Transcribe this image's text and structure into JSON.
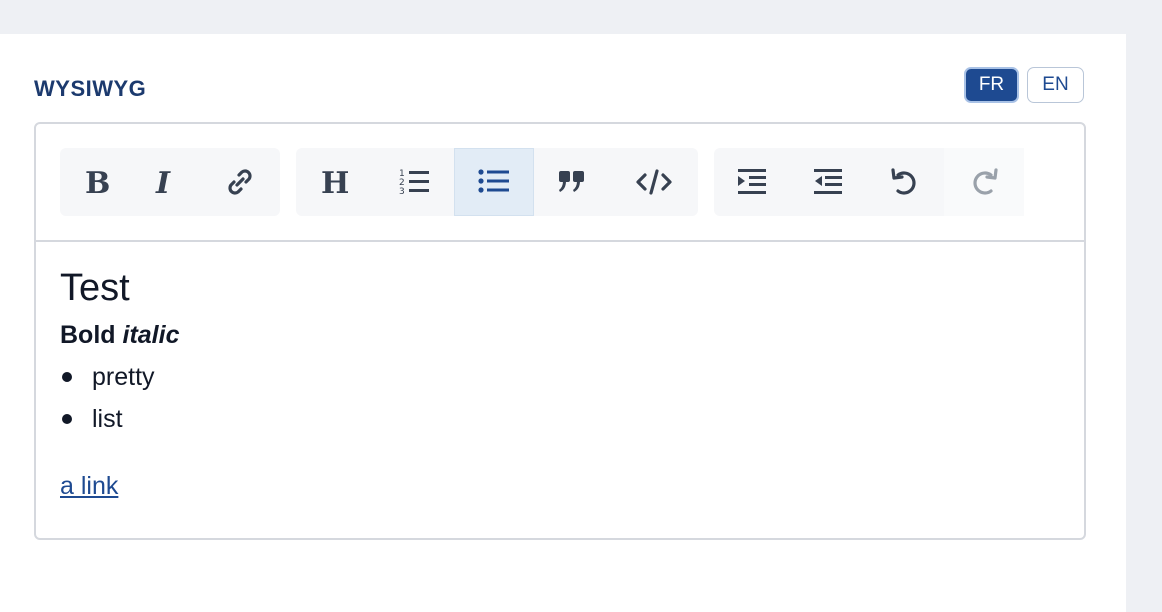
{
  "field": {
    "label": "WYSIWYG"
  },
  "languages": {
    "fr": "FR",
    "en": "EN",
    "active": "FR"
  },
  "toolbar": {
    "groups": [
      [
        "bold",
        "italic",
        "link"
      ],
      [
        "heading",
        "ordered-list",
        "bullet-list",
        "blockquote",
        "code"
      ],
      [
        "indent",
        "outdent",
        "undo",
        "redo"
      ]
    ],
    "active": "bullet-list",
    "disabled": "redo"
  },
  "content": {
    "heading": "Test",
    "bold_text": "Bold",
    "italic_text": "italic",
    "list_items": [
      "pretty",
      "list"
    ],
    "link_text": "a link"
  },
  "colors": {
    "accent": "#1e4a91",
    "label": "#1c3a6e",
    "active_bg": "#e2ecf6"
  }
}
